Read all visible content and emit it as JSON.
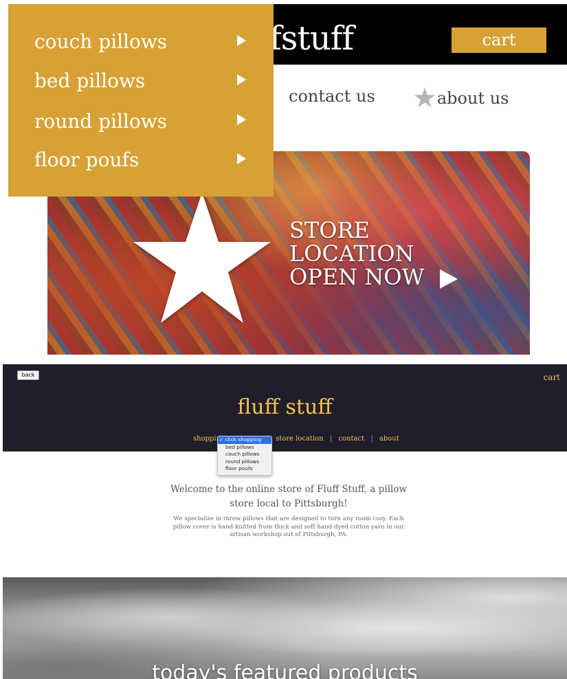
{
  "top": {
    "brand_partial": "fstuff",
    "cart_label": "cart",
    "nav": {
      "contact": "contact us",
      "about": "about us"
    },
    "dropdown": {
      "items": [
        {
          "label": "couch pillows"
        },
        {
          "label": "bed pillows"
        },
        {
          "label": "round pillows"
        },
        {
          "label": "floor poufs"
        }
      ]
    },
    "hero": {
      "lines": [
        "STORE",
        "LOCATION",
        "OPEN NOW"
      ]
    }
  },
  "bottom": {
    "back_label": "back",
    "cart_label": "cart",
    "brand": "fluff stuff",
    "nav": {
      "shopping": "shopping",
      "store_location": "store location",
      "contact": "contact",
      "about": "about",
      "separator": "|"
    },
    "select": {
      "options": [
        "click shopping",
        "bed pillows",
        "couch pillows",
        "round pillows",
        "floor poufs"
      ],
      "selected": "click shopping",
      "checkmark": "✓"
    },
    "welcome": "Welcome to the online store of Fluff Stuff, a pillow store local to Pittsburgh!",
    "description": "We specialize in throw pillows that are designed to turn any room cozy. Each pillow cover is hand-knitted from thick and soft hand-dyed cotton yarn in our artisan workshop out of Pittsburgh, PA.",
    "featured_title": "today's featured products"
  },
  "colors": {
    "accent_gold": "#d7a135",
    "nav_yellow": "#f1c64a",
    "dark_header": "#201d2c",
    "select_highlight": "#2c70e3"
  },
  "icons": [
    "star-icon",
    "play-arrow-icon",
    "chevron-right-icon",
    "checkmark-icon"
  ]
}
